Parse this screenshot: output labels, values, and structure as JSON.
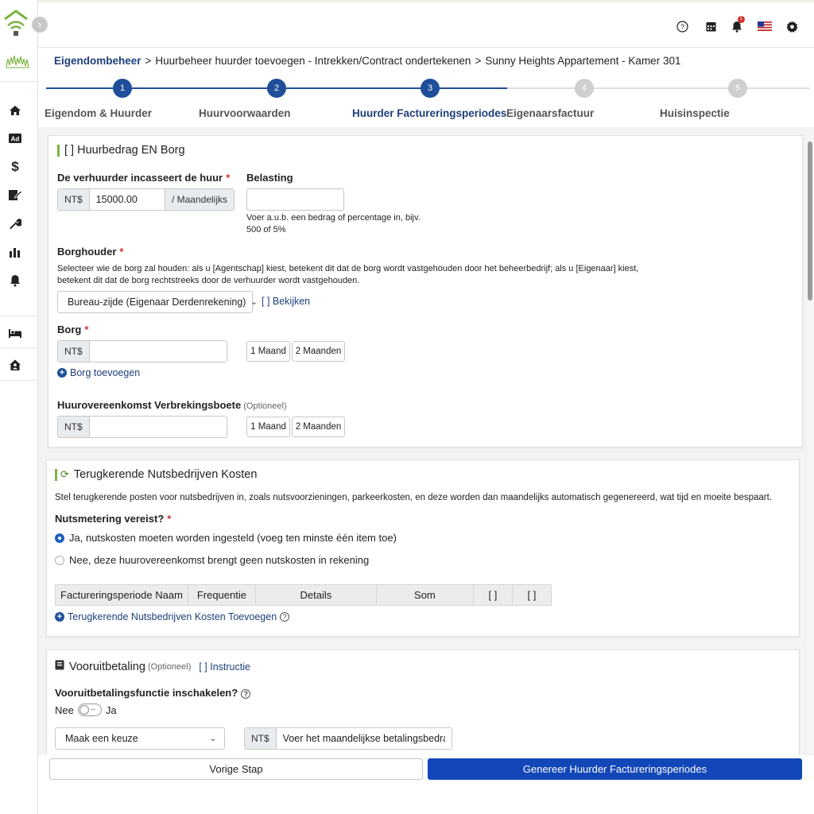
{
  "sidebar": {
    "items": [
      "home-icon",
      "ad-icon",
      "dollar-icon",
      "signature-icon",
      "wrench-icon",
      "chart-icon",
      "bell-icon",
      "bed-icon",
      "house-user-icon"
    ]
  },
  "topbar": {
    "icons": [
      "help-icon",
      "calendar-icon",
      "notification-bell-icon",
      "us-flag-icon",
      "settings-gear-icon"
    ],
    "notification_count": "1"
  },
  "breadcrumb": {
    "root": "Eigendombeheer",
    "sep1": ">",
    "middle": "Huurbeheer huurder toevoegen - Intrekken/Contract ondertekenen",
    "sep2": ">",
    "current": "Sunny Heights Appartement - Kamer 301"
  },
  "stepper": {
    "steps": [
      {
        "num": "1",
        "label": "Eigendom & Huurder",
        "state": "done"
      },
      {
        "num": "2",
        "label": "Huurvoorwaarden",
        "state": "done"
      },
      {
        "num": "3",
        "label": "Huurder Factureringsperiodes",
        "state": "active"
      },
      {
        "num": "4",
        "label": "Eigenaarsfactuur",
        "state": "todo"
      },
      {
        "num": "5",
        "label": "Huisinspectie",
        "state": "todo"
      }
    ],
    "colors": {
      "done": "#1f4f9a",
      "todo": "#cfcfcf"
    }
  },
  "rent": {
    "title": "[ ] Huurbedrag EN Borg",
    "collect_label": "De verhuurder incasseert de huur",
    "required_mark": "*",
    "currency": "NT$",
    "amount": "15000.00",
    "period": "/ Maandelijks",
    "tax_label": "Belasting",
    "tax_value": "",
    "tax_help_1": "Voer a.u.b. een bedrag of percentage in, bijv.",
    "tax_help_2": "500 of 5%",
    "holder_label": "Borghouder",
    "holder_help_1": "Selecteer wie de borg zal houden: als u [Agentschap] kiest, betekent dit dat de borg wordt vastgehouden door het beheerbedrijf; als u [Eigenaar] kiest,",
    "holder_help_2": "betekent dit dat de borg rechtstreeks door de verhuurder wordt vastgehouden.",
    "holder_selected": "Bureau-zijde (Eigenaar Derdenrekening)",
    "view_link": "[ ] Bekijken",
    "deposit_label": "Borg",
    "deposit_value": "",
    "one_month": "1 Maand",
    "two_months": "2 Maanden",
    "add_deposit": "Borg toevoegen",
    "penalty_label": "Huurovereenkomst Verbrekingsboete",
    "optional": "(Optioneel)",
    "penalty_value": ""
  },
  "utilities": {
    "title": "Terugkerende Nutsbedrijven Kosten",
    "desc": "Stel terugkerende posten voor nutsbedrijven in, zoals nutsvoorzieningen, parkeerkosten, en deze worden dan maandelijks automatisch gegenereerd, wat tijd en moeite bespaart.",
    "metering_label": "Nutsmetering vereist?",
    "required_mark": "*",
    "yes_option": "Ja, nutskosten moeten worden ingesteld (voeg ten minste één item toe)",
    "no_option": "Nee, deze huurovereenkomst brengt geen nutskosten in rekening",
    "selected": "yes",
    "columns": [
      "Factureringsperiode Naam",
      "Frequentie",
      "Details",
      "Som",
      "[ ]",
      "[ ]"
    ],
    "add_link": "Terugkerende Nutsbedrijven Kosten Toevoegen"
  },
  "prepayment": {
    "title": "Vooruitbetaling",
    "optional": "(Optioneel)",
    "instruction_link": "[ ] Instructie",
    "enable_label": "Vooruitbetalingsfunctie inschakelen?",
    "no": "Nee",
    "yes": "Ja",
    "enabled": false,
    "select_placeholder": "Maak een keuze",
    "currency": "NT$",
    "amount_placeholder": "Voer het maandelijkse betalingsbedrag in"
  },
  "footer": {
    "prev": "Vorige Stap",
    "generate": "Genereer Huurder Factureringsperiodes"
  },
  "colors": {
    "accent": "#1f4f9a",
    "primary_button": "#1347b8",
    "brand_green": "#7cb342",
    "required": "#d32f2f"
  }
}
